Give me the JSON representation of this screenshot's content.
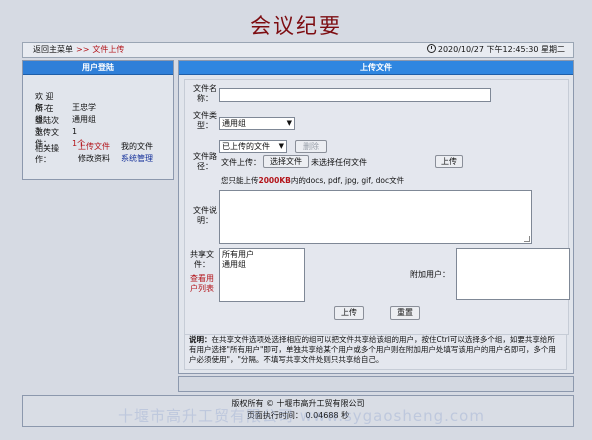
{
  "page": {
    "title": "会议纪要"
  },
  "topbar": {
    "back_label": "返回主菜单",
    "separator": ">>",
    "current": "文件上传",
    "datetime": "2020/10/27  下午12:45:30  星期二",
    "clock_icon": "clock-icon"
  },
  "user_panel": {
    "header": "用户登陆",
    "welcome_label": "欢  迎  您：",
    "welcome_value": "王忠学",
    "group_label": "所  在  组：",
    "group_value": "通用组",
    "logins_label": "登陆次数：",
    "logins_value": "1",
    "uploads_label": "上传文件：",
    "uploads_value": "1个",
    "actions_label": "相关操作：",
    "actions": {
      "upload": "上传文件",
      "my_files": "我的文件",
      "edit_profile": "修改资料",
      "sys_admin": "系统管理"
    }
  },
  "upload_panel": {
    "header": "上传文件",
    "filename_label": "文件名称：",
    "filename_value": "",
    "filetype_label": "文件类型：",
    "filetype_value": "通用组",
    "filepath_label": "文件路径：",
    "uploaded_select": "已上传的文件",
    "delete_label": "删除",
    "file_upload_label": "文件上传：",
    "choose_file_label": "选择文件",
    "no_file_label": "未选择任何文件",
    "upload_small_label": "上传",
    "limit_prefix": "您只能上传",
    "limit_size": "2000KB",
    "limit_suffix": "内的docs, pdf, jpg, gif, doc文件",
    "desc_label": "文件说明：",
    "share_label": "共享文件：",
    "view_users_label": "查看用户列表",
    "share_options": [
      "所有用户",
      "通用组"
    ],
    "extra_users_label": "附加用户：",
    "submit_label": "上传",
    "reset_label": "重置",
    "note_title": "说明：",
    "note_text": "在共享文件选项处选择相应的组可以把文件共享给该组的用户，按住Ctrl可以选择多个组，如要共享给所有用户选择\"所有用户\"即可，单独共享给某个用户或多个用户则在附加用户处填写该用户的用户名即可，多个用户必须使用\"，\"分隔。不填写共享文件处则只共享给自己。"
  },
  "footer": {
    "copyright": "版权所有 © 十堰市高升工贸有限公司",
    "exec_time": "页面执行时间： 0.04688 秒"
  },
  "watermark": "十堰市高升工贸有限公司 www.sygaosheng.com",
  "colors": {
    "accent": "#2f7fd8",
    "title": "#7d0d12",
    "link_red": "#b3141a",
    "link_blue": "#14309a"
  }
}
